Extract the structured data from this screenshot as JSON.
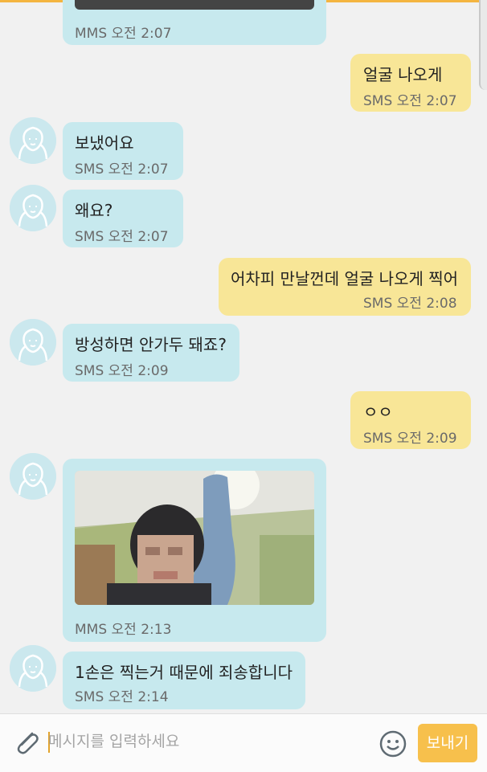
{
  "messages": [
    {
      "text": "",
      "meta": "MMS 오전 2:07"
    },
    {
      "text": "얼굴 나오게",
      "meta": "SMS 오전 2:07"
    },
    {
      "text": "보냈어요",
      "meta": "SMS 오전 2:07"
    },
    {
      "text": "왜요?",
      "meta": "SMS 오전 2:07"
    },
    {
      "text": "어차피 만날껀데 얼굴 나오게 찍어",
      "meta": "SMS 오전 2:08"
    },
    {
      "text": "방성하면 안가두 돼죠?",
      "meta": "SMS 오전 2:09"
    },
    {
      "text": "ㅇㅇ",
      "meta": "SMS 오전 2:09"
    },
    {
      "text": "",
      "meta": "MMS 오전 2:13"
    },
    {
      "text": "1손은 찍는거 때문에 죄송합니다",
      "meta": "SMS 오전 2:14"
    }
  ],
  "composer": {
    "placeholder": "메시지를 입력하세요",
    "send_label": "보내기",
    "attach_icon": "paperclip-icon",
    "emoji_icon": "smiley-icon"
  },
  "colors": {
    "incoming_bubble": "#c7e9ee",
    "outgoing_bubble": "#f8e697",
    "accent": "#f7c04c",
    "background": "#f1f1f1"
  }
}
